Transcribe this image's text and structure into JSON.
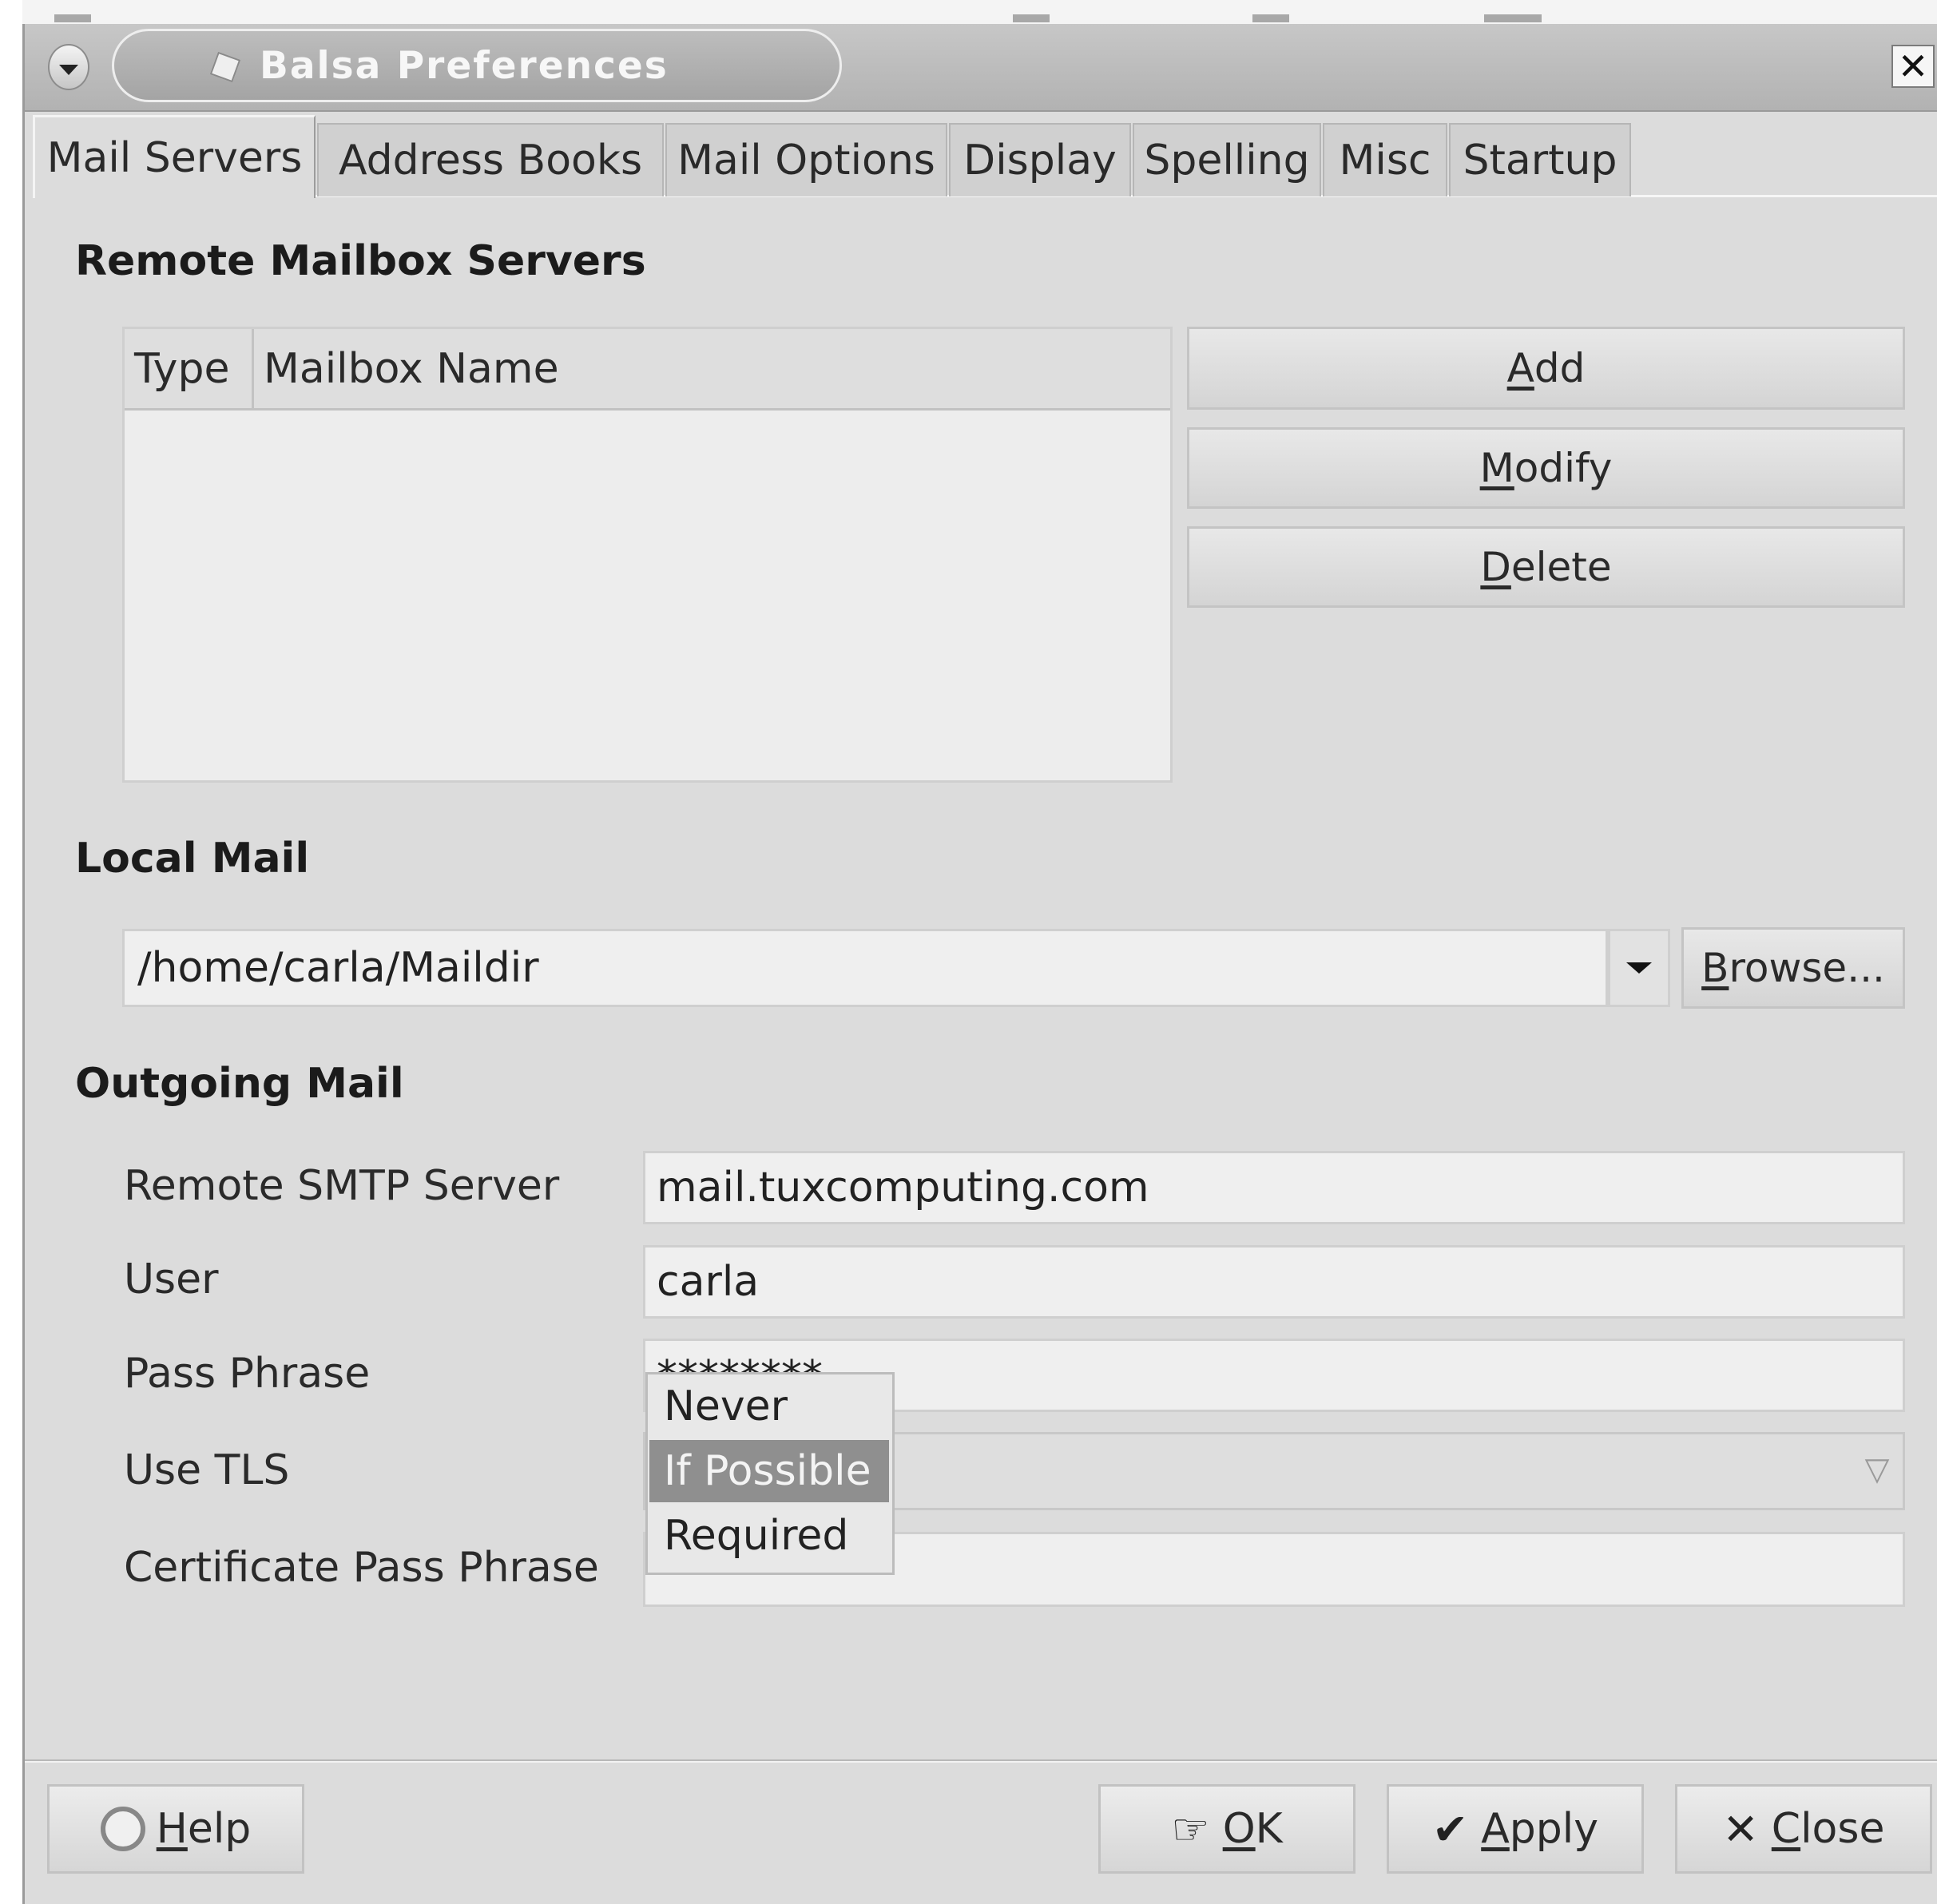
{
  "window": {
    "title": "Balsa Preferences"
  },
  "tabs": [
    {
      "label": "Mail Servers",
      "active": true
    },
    {
      "label": "Address Books",
      "active": false
    },
    {
      "label": "Mail Options",
      "active": false
    },
    {
      "label": "Display",
      "active": false
    },
    {
      "label": "Spelling",
      "active": false
    },
    {
      "label": "Misc",
      "active": false
    },
    {
      "label": "Startup",
      "active": false
    }
  ],
  "remote": {
    "heading": "Remote Mailbox Servers",
    "columns": [
      "Type",
      "Mailbox Name"
    ],
    "rows": [],
    "buttons": {
      "add_u": "A",
      "add_rest": "dd",
      "modify_u": "M",
      "modify_rest": "odify",
      "delete_u": "D",
      "delete_rest": "elete"
    }
  },
  "local": {
    "heading": "Local Mail",
    "path": "/home/carla/Maildir",
    "browse_u": "B",
    "browse_rest": "rowse..."
  },
  "outgoing": {
    "heading": "Outgoing Mail",
    "smtp_label": "Remote SMTP Server",
    "smtp_value": "mail.tuxcomputing.com",
    "user_label": "User",
    "user_value": "carla",
    "pass_label": "Pass Phrase",
    "pass_value": "********",
    "tls_label": "Use TLS",
    "tls_options": [
      "Never",
      "If Possible",
      "Required"
    ],
    "tls_selected": "If Possible",
    "cert_label": "Certificate Pass Phrase",
    "cert_value": ""
  },
  "footer": {
    "help_u": "H",
    "help_rest": "elp",
    "ok_u": "O",
    "ok_rest": "K",
    "apply_u": "A",
    "apply_rest": "pply",
    "close_u": "C",
    "close_rest": "lose"
  }
}
